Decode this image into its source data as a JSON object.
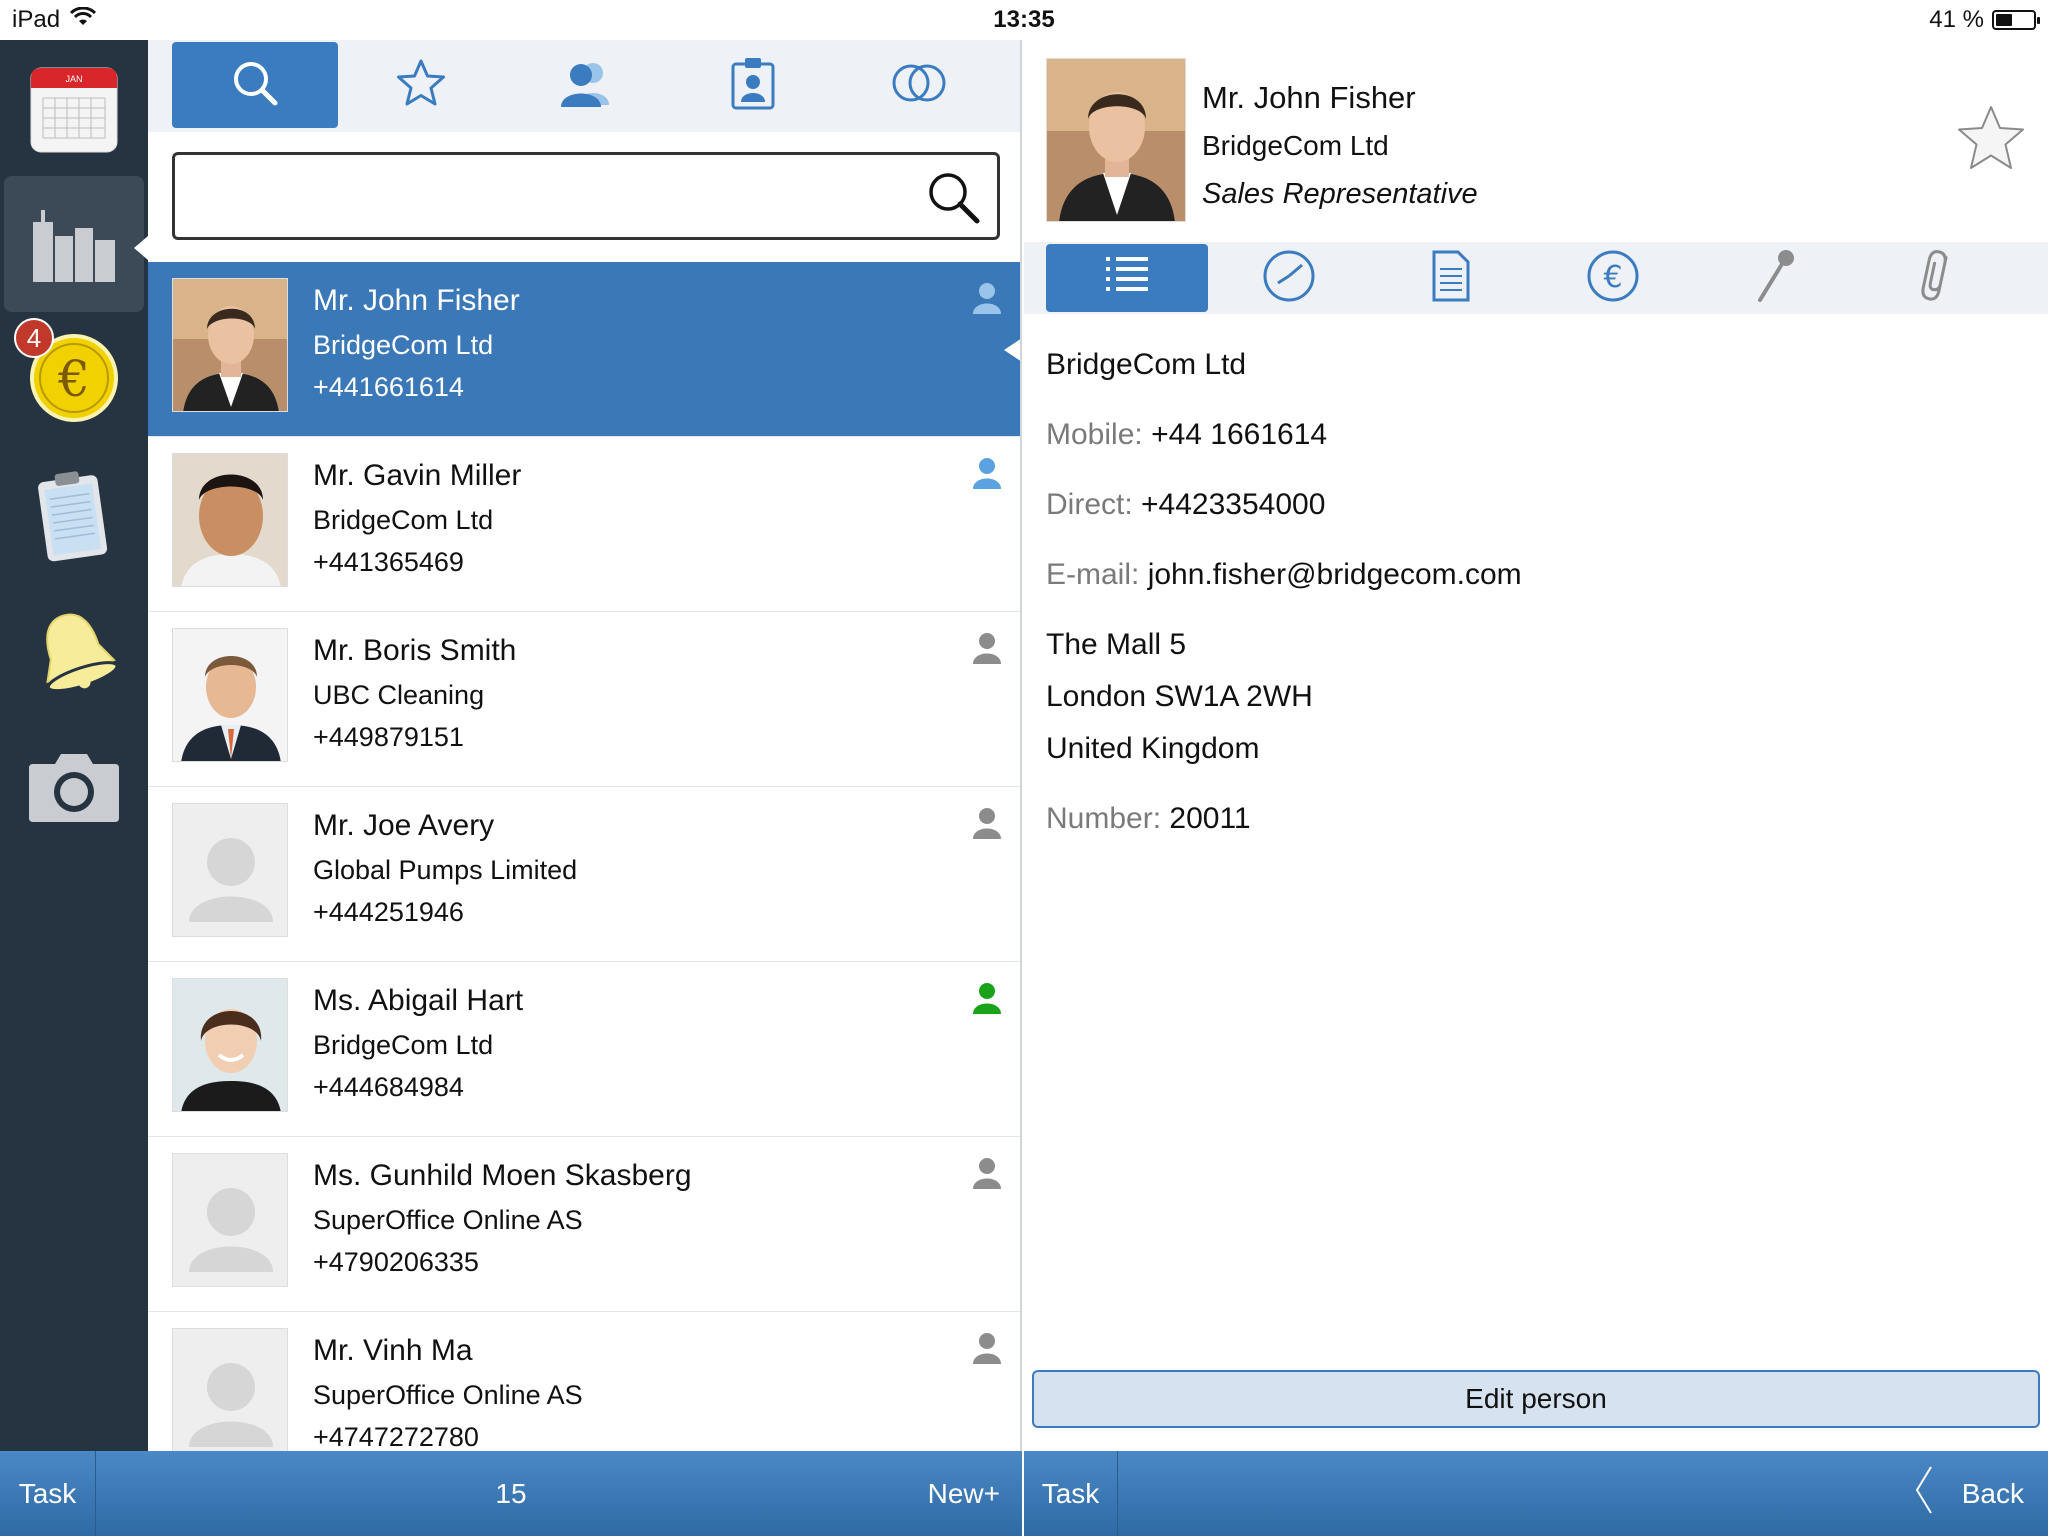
{
  "status": {
    "device": "iPad",
    "time": "13:35",
    "battery": "41 %"
  },
  "rail": {
    "badge_count": "4"
  },
  "search": {
    "value": "",
    "placeholder": ""
  },
  "contacts": [
    {
      "name": "Mr. John Fisher",
      "company": "BridgeCom Ltd",
      "phone": "+441661614",
      "selected": true,
      "icon_color": "#9bc4ea"
    },
    {
      "name": "Mr. Gavin Miller",
      "company": "BridgeCom Ltd",
      "phone": "+441365469",
      "icon_color": "#5aa3e0"
    },
    {
      "name": "Mr. Boris Smith",
      "company": "UBC Cleaning",
      "phone": "+449879151",
      "icon_color": "#8c8c8c"
    },
    {
      "name": "Mr. Joe Avery",
      "company": "Global Pumps Limited",
      "phone": "+444251946",
      "icon_color": "#8c8c8c"
    },
    {
      "name": "Ms. Abigail Hart",
      "company": "BridgeCom Ltd",
      "phone": "+444684984",
      "icon_color": "#1aa31a"
    },
    {
      "name": "Ms. Gunhild Moen Skasberg",
      "company": "SuperOffice Online AS",
      "phone": "+4790206335",
      "icon_color": "#8c8c8c"
    },
    {
      "name": "Mr. Vinh Ma",
      "company": "SuperOffice Online AS",
      "phone": "+4747272780",
      "icon_color": "#8c8c8c"
    }
  ],
  "detail": {
    "name": "Mr. John Fisher",
    "company": "BridgeCom Ltd",
    "title": "Sales Representative",
    "company_line": "BridgeCom Ltd",
    "mobile_label": "Mobile:",
    "mobile": "+44 1661614",
    "direct_label": "Direct:",
    "direct": "+4423354000",
    "email_label": "E-mail:",
    "email": "john.fisher@bridgecom.com",
    "address1": "The Mall 5",
    "address2": "London  SW1A 2WH",
    "address3": "United Kingdom",
    "number_label": "Number:",
    "number": "20011",
    "edit_button": "Edit person"
  },
  "bottom_left": {
    "task": "Task",
    "count": "15",
    "new": "New+"
  },
  "bottom_right": {
    "task": "Task",
    "back": "Back"
  },
  "colors": {
    "accent": "#3a7cbf",
    "rail": "#263442",
    "selected_row": "#3b78b8"
  }
}
